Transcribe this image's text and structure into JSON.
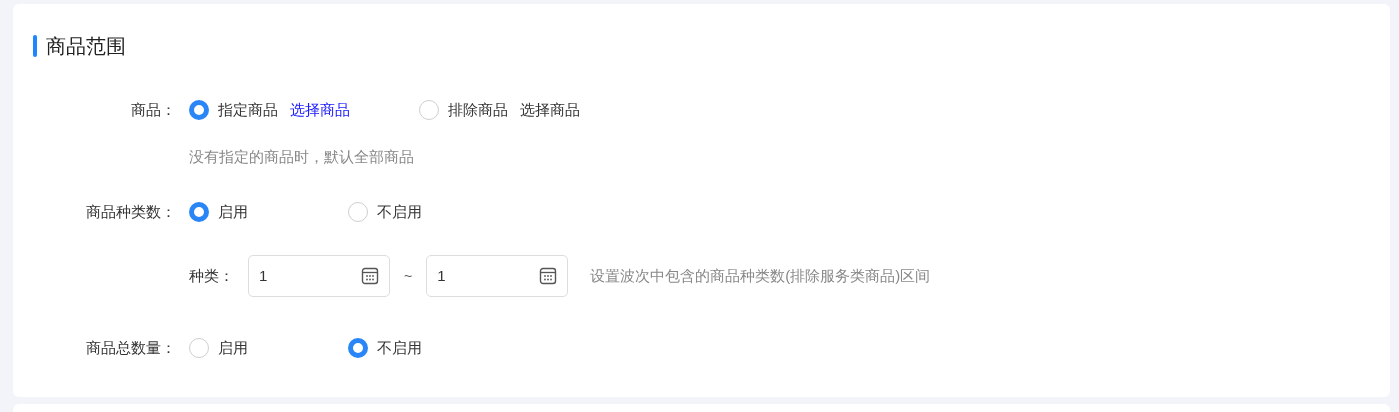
{
  "section": {
    "title": "商品范围"
  },
  "goods": {
    "label": "商品：",
    "options": [
      {
        "label": "指定商品",
        "link": "选择商品",
        "selected": true
      },
      {
        "label": "排除商品",
        "link": "选择商品",
        "selected": false
      }
    ],
    "hint": "没有指定的商品时，默认全部商品"
  },
  "kind_count": {
    "label": "商品种类数：",
    "options": [
      {
        "label": "启用",
        "selected": true
      },
      {
        "label": "不启用",
        "selected": false
      }
    ],
    "range": {
      "label": "种类：",
      "min": "1",
      "separator": "~",
      "max": "1",
      "hint": "设置波次中包含的商品种类数(排除服务类商品)区间"
    }
  },
  "total_quantity": {
    "label": "商品总数量：",
    "options": [
      {
        "label": "启用",
        "selected": false
      },
      {
        "label": "不启用",
        "selected": true
      }
    ]
  }
}
